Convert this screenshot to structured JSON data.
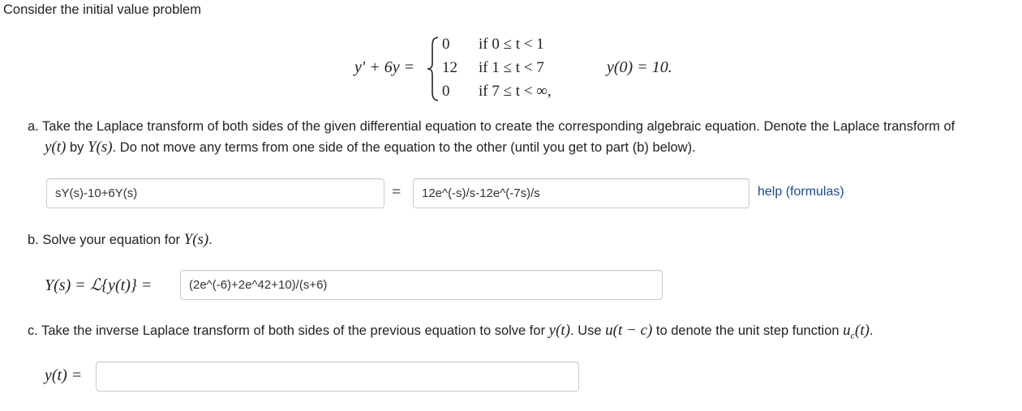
{
  "intro": "Consider the initial value problem",
  "equation": {
    "lhs": "y′ + 6y =",
    "cases": [
      {
        "value": "0",
        "condition": "if 0 ≤ t < 1"
      },
      {
        "value": "12",
        "condition": "if 1 ≤ t < 7"
      },
      {
        "value": "0",
        "condition": "if 7 ≤ t < ∞,"
      }
    ],
    "initial_condition": "y(0) = 10."
  },
  "part_a": {
    "line1": "a. Take the Laplace transform of both sides of the given differential equation to create the corresponding algebraic equation. Denote the Laplace transform of",
    "line2_yt": "y(t)",
    "line2_by": " by ",
    "line2_Ys": "Y(s)",
    "line2_rest": ". Do not move any terms from one side of the equation to the other (until you get to part (b) below).",
    "lhs_value": "sY(s)-10+6Y(s)",
    "equals": "=",
    "rhs_value": "12e^(-s)/s-12e^(-7s)/s",
    "help_link": "help (formulas)"
  },
  "part_b": {
    "prompt_pre": "b. Solve your equation for ",
    "prompt_Ys": "Y(s)",
    "prompt_post": ".",
    "label": "Y(s) = ℒ{y(t)} =",
    "answer_value": "(2e^(-6)+2e^42+10)/(s+6)"
  },
  "part_c": {
    "prompt_pre": "c. Take the inverse Laplace transform of both sides of the previous equation to solve for ",
    "prompt_yt": "y(t)",
    "prompt_mid": ". Use ",
    "prompt_u": "u(t − c)",
    "prompt_mid2": " to denote the unit step function ",
    "prompt_uc": "u",
    "prompt_uc_sub": "c",
    "prompt_uc_arg": "(t)",
    "prompt_post": ".",
    "label": "y(t) =",
    "answer_value": ""
  }
}
